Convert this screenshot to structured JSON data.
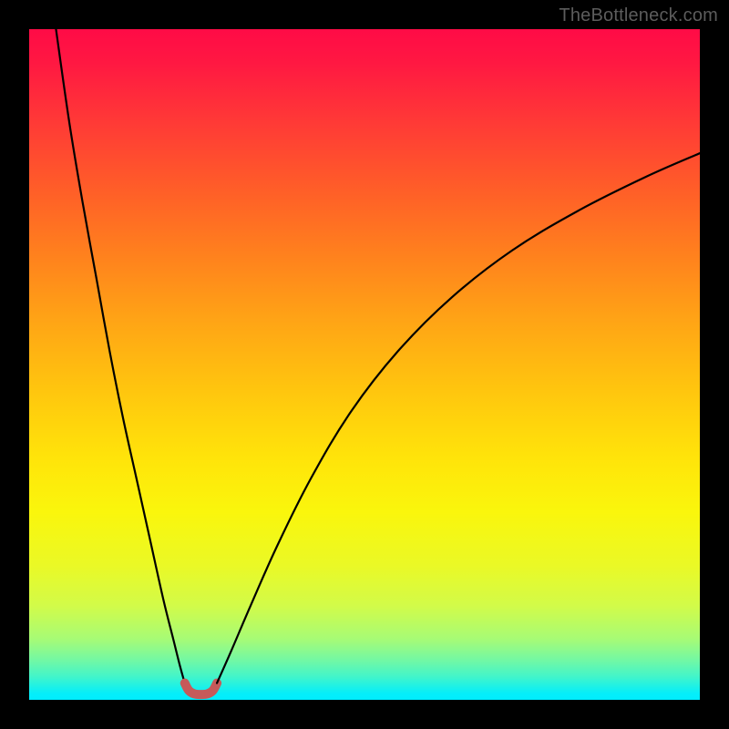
{
  "watermark": "TheBottleneck.com",
  "chart_data": {
    "type": "line",
    "title": "",
    "xlabel": "",
    "ylabel": "",
    "xlim": [
      0,
      100
    ],
    "ylim": [
      0,
      100
    ],
    "grid": false,
    "legend": false,
    "background_gradient": {
      "top_color": "#ff0b46",
      "bottom_color": "#00edff",
      "description": "vertical red-to-cyan spectrum representing bottleneck severity (top=high, bottom=low)"
    },
    "series": [
      {
        "name": "left_branch",
        "description": "steep descending curve from upper-left into trough",
        "x": [
          4,
          6,
          8,
          10,
          12,
          14,
          16,
          18,
          20,
          21.5,
          22.5,
          23.2
        ],
        "y": [
          100,
          86,
          74,
          63,
          52,
          42,
          33,
          24,
          15,
          9,
          5,
          2.5
        ]
      },
      {
        "name": "trough",
        "description": "rounded minimum of the V, drawn in muted red",
        "color": "#c65a5a",
        "x": [
          23.2,
          23.8,
          24.6,
          25.6,
          26.6,
          27.4,
          28.0
        ],
        "y": [
          2.5,
          1.4,
          0.9,
          0.8,
          0.9,
          1.4,
          2.5
        ]
      },
      {
        "name": "right_branch",
        "description": "rising curve from trough toward upper-right, flattening",
        "x": [
          28.0,
          30,
          33,
          37,
          42,
          48,
          55,
          63,
          72,
          82,
          92,
          100
        ],
        "y": [
          2.5,
          7,
          14,
          23,
          33,
          43,
          52,
          60,
          67,
          73,
          78,
          81.5
        ]
      }
    ]
  }
}
